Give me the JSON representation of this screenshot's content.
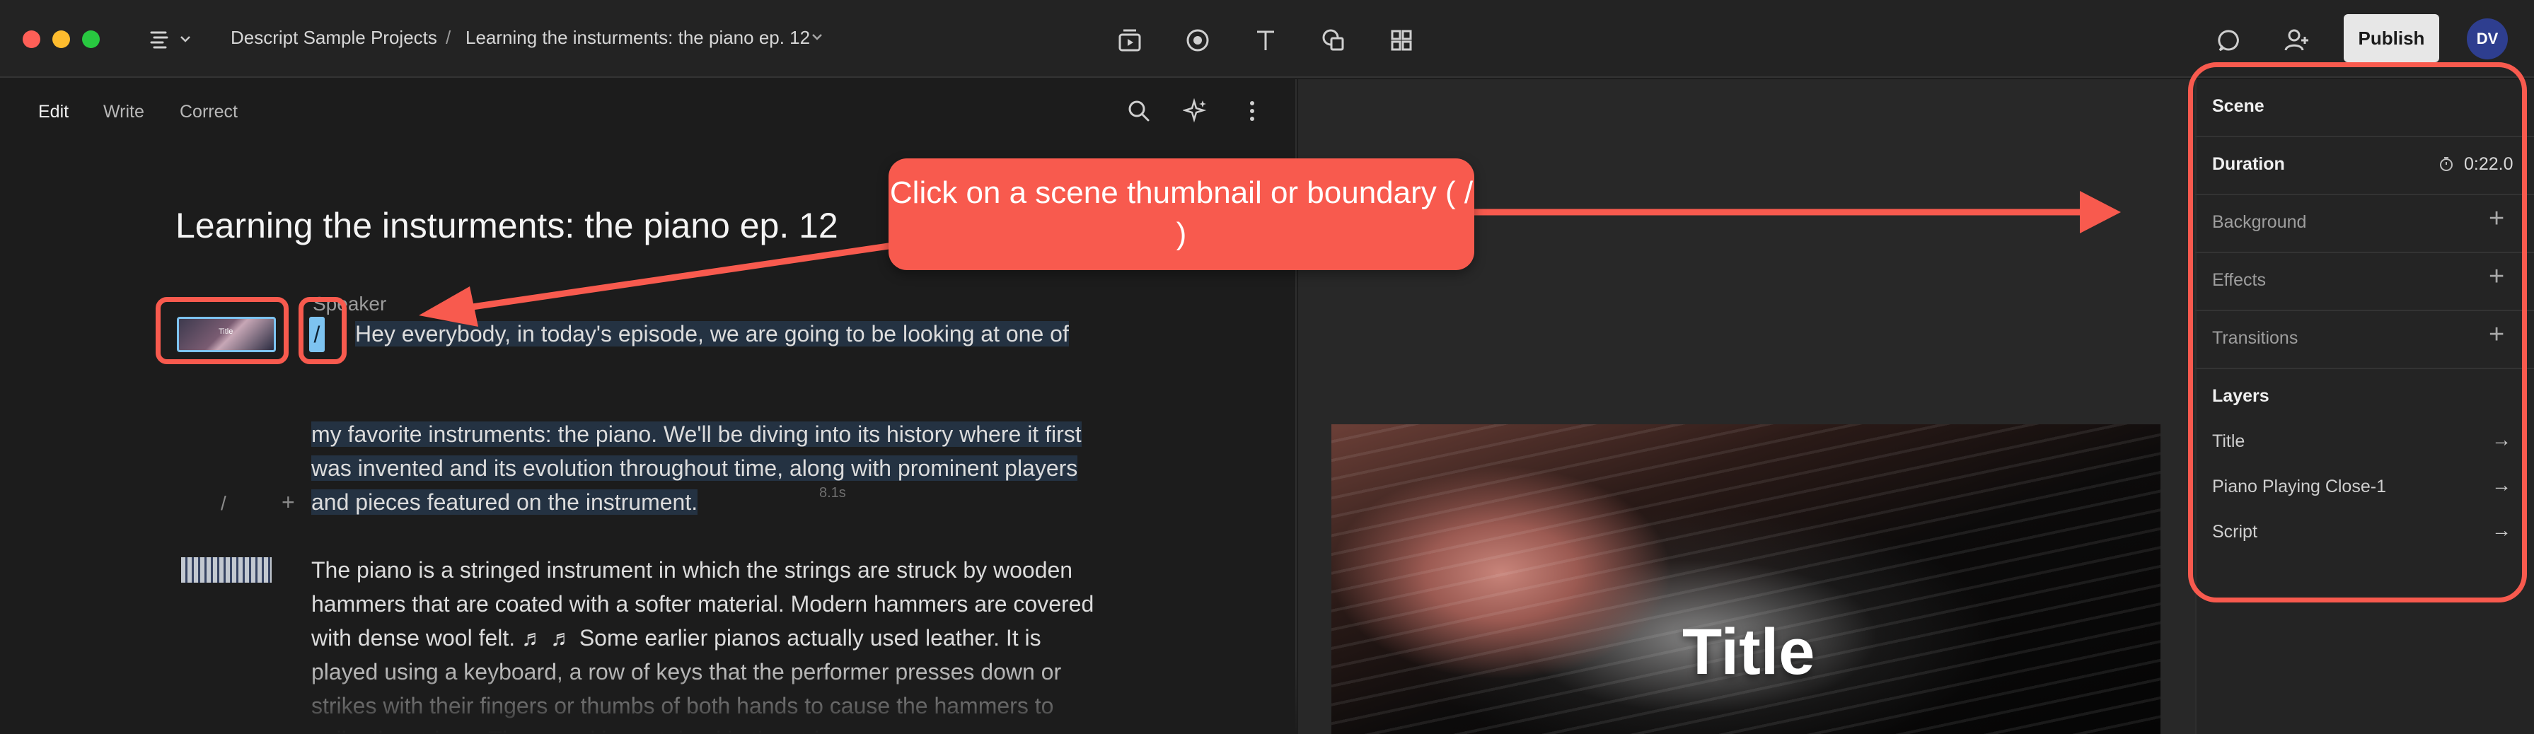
{
  "breadcrumb": {
    "project": "Descript Sample Projects",
    "separator": "/",
    "composition": "Learning the insturments: the piano ep. 12"
  },
  "header": {
    "publish_label": "Publish",
    "avatar_initials": "DV"
  },
  "editor": {
    "modes": [
      "Edit",
      "Write",
      "Correct"
    ],
    "doc_title": "Learning the insturments: the piano ep. 12",
    "speaker": "Speaker",
    "paragraph1": "Hey everybody, in today's episode, we are going to be looking at one of",
    "paragraph2": "my favorite instruments: the piano. We'll be diving into its history where it first was invented and its evolution throughout time, along with prominent players and pieces featured on the instrument.",
    "gap_label": "8.1s",
    "paragraph3": "The piano is a stringed instrument in which the strings are struck by wooden hammers that are coated with a softer material. Modern hammers are covered with dense wool felt. ♬ ♬ Some earlier pianos actually used leather. It is played using a keyboard, a row of keys that the performer presses down or strikes with their fingers or thumbs of both hands to cause the hammers to strike the strings. The sound is sustained in the strings.",
    "boundary_char": "/",
    "scene_thumb_label": "Title"
  },
  "canvas": {
    "title_text": "Title"
  },
  "properties": {
    "scene_label": "Scene",
    "duration_label": "Duration",
    "duration_value": "0:22.0",
    "background_label": "Background",
    "effects_label": "Effects",
    "transitions_label": "Transitions",
    "layers_label": "Layers",
    "layers": [
      "Title",
      "Piano Playing Close-1",
      "Script"
    ]
  },
  "annotation": {
    "callout_text": "Click on a scene thumbnail or boundary ( / )",
    "color": "#f85a4e"
  },
  "colors": {
    "accent": "#7dc3f0",
    "publish_bg": "#e7e7e7",
    "avatar_bg": "#2e3e8f"
  }
}
